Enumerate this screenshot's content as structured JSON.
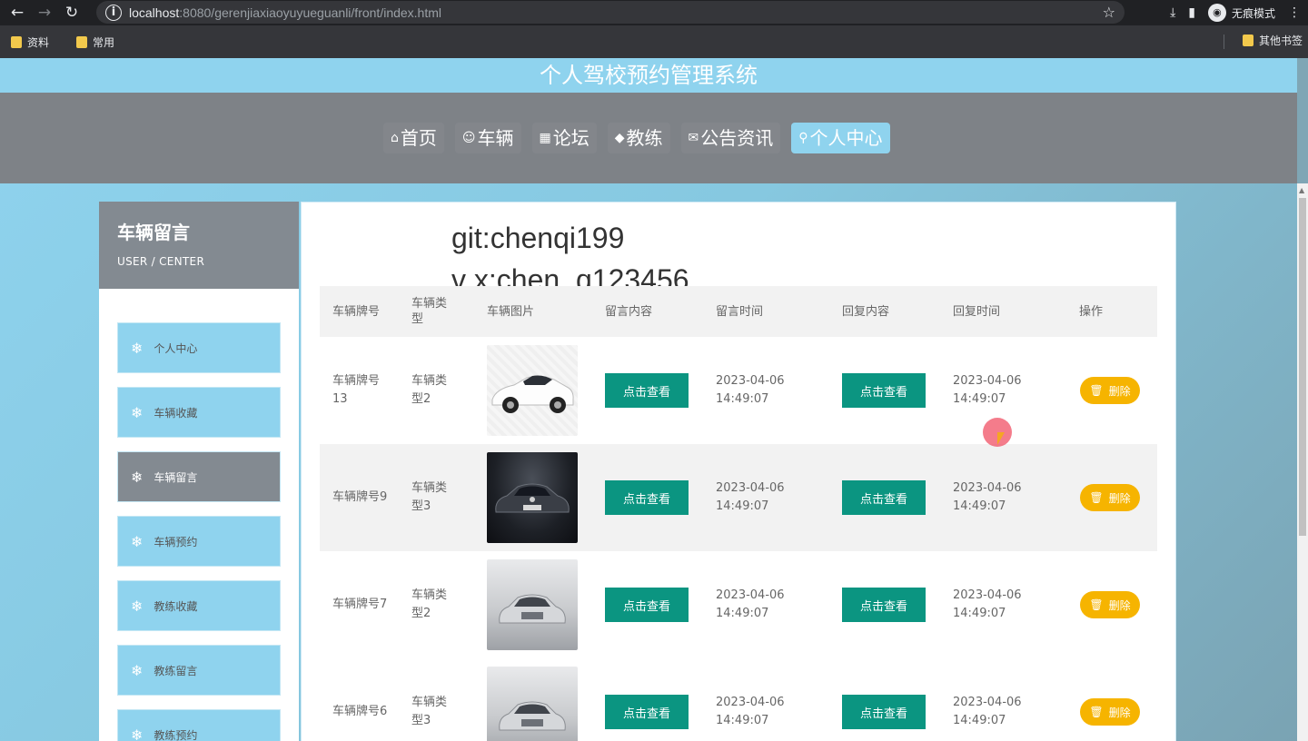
{
  "browser": {
    "url_host": "localhost",
    "url_rest": ":8080/gerenjiaxiaoyuyueguanli/front/index.html",
    "incognito_label": "无痕模式",
    "bookmarks": [
      "资料",
      "常用"
    ],
    "other_bookmarks": "其他书签"
  },
  "site": {
    "title": "个人驾校预约管理系统",
    "nav": [
      {
        "label": "首页",
        "icon": "home-icon"
      },
      {
        "label": "车辆",
        "icon": "car-icon"
      },
      {
        "label": "论坛",
        "icon": "forum-icon"
      },
      {
        "label": "教练",
        "icon": "education-icon"
      },
      {
        "label": "公告资讯",
        "icon": "mail-icon"
      },
      {
        "label": "个人中心",
        "icon": "user-icon",
        "active": true
      }
    ]
  },
  "sidebar": {
    "title": "车辆留言",
    "subtitle": "USER / CENTER",
    "items": [
      "个人中心",
      "车辆收藏",
      "车辆留言",
      "车辆预约",
      "教练收藏",
      "教练留言",
      "教练预约"
    ],
    "active_index": 2
  },
  "watermark": {
    "line1": "git:chenqi199",
    "line2": "v x:chen_q123456"
  },
  "table": {
    "headers": [
      "车辆牌号",
      "车辆类型",
      "车辆图片",
      "留言内容",
      "留言时间",
      "回复内容",
      "回复时间",
      "操作"
    ],
    "view_label": "点击查看",
    "delete_label": "删除",
    "rows": [
      {
        "plate": "车辆牌号13",
        "type": "车辆类型2",
        "image": "car-white",
        "msg_time": "2023-04-06 14:49:07",
        "reply_time": "2023-04-06 14:49:07"
      },
      {
        "plate": "车辆牌号9",
        "type": "车辆类型3",
        "image": "car-dark",
        "msg_time": "2023-04-06 14:49:07",
        "reply_time": "2023-04-06 14:49:07"
      },
      {
        "plate": "车辆牌号7",
        "type": "车辆类型2",
        "image": "car-silver",
        "msg_time": "2023-04-06 14:49:07",
        "reply_time": "2023-04-06 14:49:07"
      },
      {
        "plate": "车辆牌号6",
        "type": "车辆类型3",
        "image": "car-silver",
        "msg_time": "2023-04-06 14:49:07",
        "reply_time": "2023-04-06 14:49:07"
      }
    ]
  },
  "colors": {
    "accent_blue": "#8fd3ee",
    "nav_gray": "#7e8287",
    "button_green": "#0b9581",
    "delete_yellow": "#f6b400"
  }
}
